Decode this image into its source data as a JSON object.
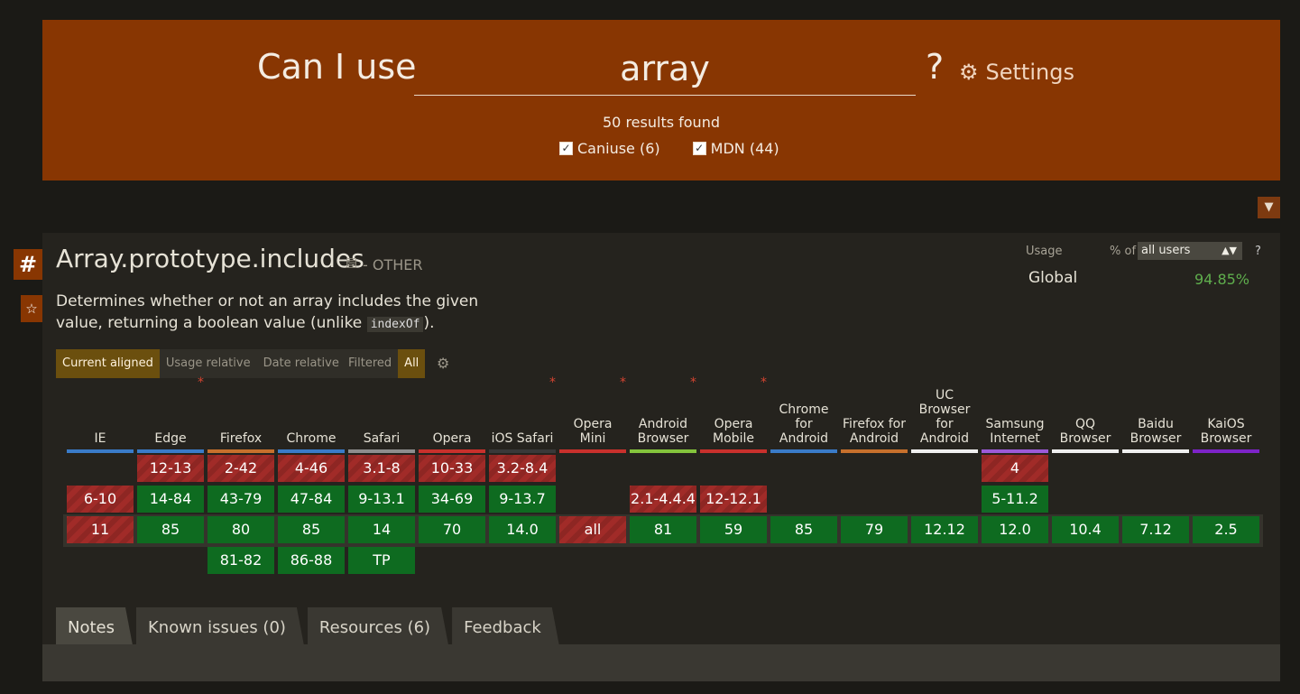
{
  "header": {
    "title": "Can I use",
    "search_value": "array",
    "help": "?",
    "settings_label": "Settings",
    "results_text": "50 results found",
    "filters": [
      {
        "label": "Caniuse (6)",
        "checked": true
      },
      {
        "label": "MDN (44)",
        "checked": true
      }
    ]
  },
  "feature": {
    "anchor": "#",
    "star": "☆",
    "title": "Array.prototype.includes",
    "category": "- OTHER",
    "description_pre": "Determines whether or not an array includes the given value, returning a boolean value (unlike ",
    "description_code": "indexOf",
    "description_post": ").",
    "usage": {
      "label": "Usage",
      "pct_of": "% of",
      "selected": "all users",
      "help": "?",
      "global_label": "Global",
      "global_value": "94.85%"
    },
    "view_tabs": [
      "Current aligned",
      "Usage relative",
      "Date relative"
    ],
    "filter_tabs": [
      "Filtered",
      "All"
    ]
  },
  "browsers": [
    {
      "name": "IE",
      "color": "#3a7bc8",
      "star": false
    },
    {
      "name": "Edge",
      "color": "#3a7bc8",
      "star": true
    },
    {
      "name": "Firefox",
      "color": "#c7702c",
      "star": false
    },
    {
      "name": "Chrome",
      "color": "#3a7bc8",
      "star": false
    },
    {
      "name": "Safari",
      "color": "#8d8d8d",
      "star": false
    },
    {
      "name": "Opera",
      "color": "#c9302c",
      "star": false
    },
    {
      "name": "iOS Safari",
      "color": "#393939",
      "star": true
    },
    {
      "name": "Opera Mini",
      "color": "#c9302c",
      "star": true
    },
    {
      "name": "Android Browser",
      "color": "#84c43c",
      "star": true
    },
    {
      "name": "Opera Mobile",
      "color": "#c9302c",
      "star": true
    },
    {
      "name": "Chrome for Android",
      "color": "#3a7bc8",
      "star": false
    },
    {
      "name": "Firefox for Android",
      "color": "#c7702c",
      "star": false
    },
    {
      "name": "UC Browser for Android",
      "color": "#f0f0f0",
      "star": false
    },
    {
      "name": "Samsung Internet",
      "color": "#9c5ad8",
      "star": false
    },
    {
      "name": "QQ Browser",
      "color": "#f0f0f0",
      "star": false
    },
    {
      "name": "Baidu Browser",
      "color": "#f0f0f0",
      "star": false
    },
    {
      "name": "KaiOS Browser",
      "color": "#7d23c8",
      "star": false
    }
  ],
  "support_rows": [
    [
      null,
      [
        "12-13",
        "n"
      ],
      [
        "2-42",
        "n"
      ],
      [
        "4-46",
        "n"
      ],
      [
        "3.1-8",
        "n"
      ],
      [
        "10-33",
        "n"
      ],
      [
        "3.2-8.4",
        "n"
      ],
      null,
      null,
      null,
      null,
      null,
      null,
      [
        "4",
        "n"
      ],
      null,
      null,
      null
    ],
    [
      [
        "6-10",
        "n"
      ],
      [
        "14-84",
        "y"
      ],
      [
        "43-79",
        "y"
      ],
      [
        "47-84",
        "y"
      ],
      [
        "9-13.1",
        "y"
      ],
      [
        "34-69",
        "y"
      ],
      [
        "9-13.7",
        "y"
      ],
      null,
      [
        "2.1-4.4.4",
        "n"
      ],
      [
        "12-12.1",
        "n"
      ],
      null,
      null,
      null,
      [
        "5-11.2",
        "y"
      ],
      null,
      null,
      null
    ],
    [
      [
        "11",
        "n"
      ],
      [
        "85",
        "y"
      ],
      [
        "80",
        "y"
      ],
      [
        "85",
        "y"
      ],
      [
        "14",
        "y"
      ],
      [
        "70",
        "y"
      ],
      [
        "14.0",
        "y"
      ],
      [
        "all",
        "n"
      ],
      [
        "81",
        "y"
      ],
      [
        "59",
        "y"
      ],
      [
        "85",
        "y"
      ],
      [
        "79",
        "y"
      ],
      [
        "12.12",
        "y"
      ],
      [
        "12.0",
        "y"
      ],
      [
        "10.4",
        "y"
      ],
      [
        "7.12",
        "y"
      ],
      [
        "2.5",
        "y"
      ]
    ],
    [
      null,
      null,
      [
        "81-82",
        "y"
      ],
      [
        "86-88",
        "y"
      ],
      [
        "TP",
        "y"
      ],
      null,
      null,
      null,
      null,
      null,
      null,
      null,
      null,
      null,
      null,
      null,
      null
    ]
  ],
  "bottom_tabs": [
    "Notes",
    "Known issues (0)",
    "Resources (6)",
    "Feedback"
  ]
}
